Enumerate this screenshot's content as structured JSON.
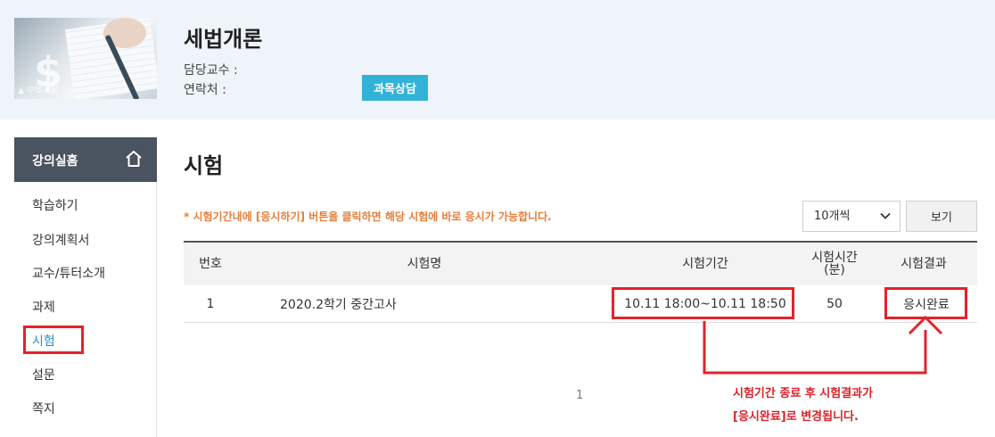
{
  "course": {
    "title": "세법개론",
    "professor_label": "담당교수 :",
    "contact_label": "연락처 :",
    "consult_button": "과목상담",
    "thumb_glyph": "$",
    "thumb_watermark": "▲ 中华人民"
  },
  "sidebar": {
    "header": "강의실홈",
    "items": [
      {
        "label": "학습하기"
      },
      {
        "label": "강의계획서"
      },
      {
        "label": "교수/튜터소개"
      },
      {
        "label": "과제"
      },
      {
        "label": "시험"
      },
      {
        "label": "설문"
      },
      {
        "label": "쪽지"
      }
    ]
  },
  "main": {
    "title": "시험",
    "notice": "* 시험기간내에 [응시하기] 버튼을 클릭하면 해당 시험에 바로 응시가 가능합니다.",
    "page_size": "10개씩",
    "view_button": "보기",
    "columns": [
      "번호",
      "시험명",
      "시험기간",
      "시험시간\n(분)",
      "시험결과"
    ],
    "rows": [
      {
        "no": "1",
        "name": "2020.2학기  중간고사",
        "period": "10.11 18:00~10.11 18:50",
        "minutes": "50",
        "result": "응시완료"
      }
    ],
    "pagination": "1",
    "annotation_line1": "시험기간 종료 후 시험결과가",
    "annotation_line2": "[응시완료]로 변경됩니다."
  },
  "colors": {
    "highlight": "#e3222b",
    "accent": "#33b2d8",
    "notice": "#e67e3a",
    "sidebar_head": "#4a5360"
  }
}
